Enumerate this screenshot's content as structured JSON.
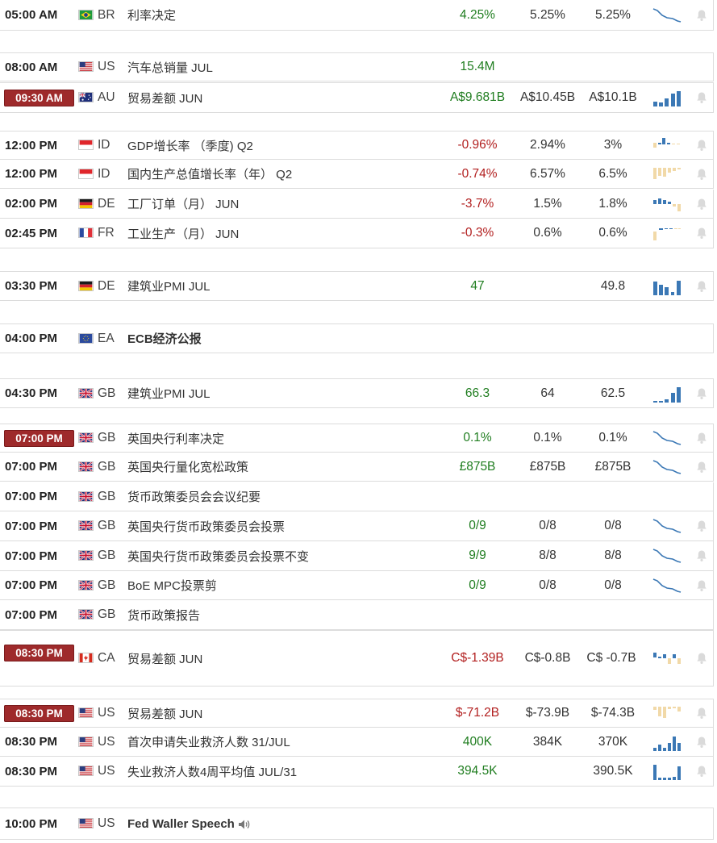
{
  "colors": {
    "positive": "#1f7d1f",
    "negative": "#b21f1f",
    "highlight_time": "#9e2a2b",
    "spark_blue": "#3b78b5",
    "spark_tan": "#f1d9a8"
  },
  "events": [
    {
      "time": "05:00 AM",
      "highlight": false,
      "flag": "BR",
      "country": "BR",
      "event": "利率决定",
      "bold": false,
      "actual": "4.25%",
      "actual_color": "positive",
      "forecast": "5.25%",
      "previous": "5.25%",
      "chart": "line-down",
      "bell": true
    },
    {
      "time": "08:00 AM",
      "highlight": false,
      "flag": "US",
      "country": "US",
      "event": "汽车总销量 JUL",
      "bold": false,
      "actual": "15.4M",
      "actual_color": "positive",
      "forecast": "",
      "previous": "",
      "chart": "none",
      "bell": false
    },
    {
      "time": "09:30 AM",
      "highlight": true,
      "flag": "AU",
      "country": "AU",
      "event": "贸易差额 JUN",
      "bold": false,
      "actual": "A$9.681B",
      "actual_color": "positive",
      "forecast": "A$10.45B",
      "previous": "A$10.1B",
      "chart": "bars-au",
      "bell": true
    },
    {
      "time": "12:00 PM",
      "highlight": false,
      "flag": "ID",
      "country": "ID",
      "event": "GDP增长率 （季度) Q2",
      "bold": false,
      "actual": "-0.96%",
      "actual_color": "negative",
      "forecast": "2.94%",
      "previous": "3%",
      "chart": "bars-id1",
      "bell": true
    },
    {
      "time": "12:00 PM",
      "highlight": false,
      "flag": "ID",
      "country": "ID",
      "event": "国内生产总值增长率（年） Q2",
      "bold": false,
      "actual": "-0.74%",
      "actual_color": "negative",
      "forecast": "6.57%",
      "previous": "6.5%",
      "chart": "bars-id2",
      "bell": true
    },
    {
      "time": "02:00 PM",
      "highlight": false,
      "flag": "DE",
      "country": "DE",
      "event": "工厂订单（月） JUN",
      "bold": false,
      "actual": "-3.7%",
      "actual_color": "negative",
      "forecast": "1.5%",
      "previous": "1.8%",
      "chart": "bars-de1",
      "bell": true
    },
    {
      "time": "02:45 PM",
      "highlight": false,
      "flag": "FR",
      "country": "FR",
      "event": "工业生产（月） JUN",
      "bold": false,
      "actual": "-0.3%",
      "actual_color": "negative",
      "forecast": "0.6%",
      "previous": "0.6%",
      "chart": "bars-fr",
      "bell": true
    },
    {
      "time": "03:30 PM",
      "highlight": false,
      "flag": "DE",
      "country": "DE",
      "event": "建筑业PMI JUL",
      "bold": false,
      "actual": "47",
      "actual_color": "positive",
      "forecast": "",
      "previous": "49.8",
      "chart": "bars-de2",
      "bell": true
    },
    {
      "time": "04:00 PM",
      "highlight": false,
      "flag": "EU",
      "country": "EA",
      "event": "ECB经济公报",
      "bold": true,
      "actual": "",
      "actual_color": "positive",
      "forecast": "",
      "previous": "",
      "chart": "none",
      "bell": false
    },
    {
      "time": "04:30 PM",
      "highlight": false,
      "flag": "GB",
      "country": "GB",
      "event": "建筑业PMI JUL",
      "bold": false,
      "actual": "66.3",
      "actual_color": "positive",
      "forecast": "64",
      "previous": "62.5",
      "chart": "bars-gb",
      "bell": true
    },
    {
      "time": "07:00 PM",
      "highlight": true,
      "flag": "GB",
      "country": "GB",
      "event": "英国央行利率决定",
      "bold": false,
      "actual": "0.1%",
      "actual_color": "positive",
      "forecast": "0.1%",
      "previous": "0.1%",
      "chart": "line-down",
      "bell": true
    },
    {
      "time": "07:00 PM",
      "highlight": false,
      "flag": "GB",
      "country": "GB",
      "event": "英国央行量化宽松政策",
      "bold": false,
      "actual": "£875B",
      "actual_color": "positive",
      "forecast": "£875B",
      "previous": "£875B",
      "chart": "line-down",
      "bell": true
    },
    {
      "time": "07:00 PM",
      "highlight": false,
      "flag": "GB",
      "country": "GB",
      "event": "货币政策委员会会议纪要",
      "bold": false,
      "actual": "",
      "actual_color": "positive",
      "forecast": "",
      "previous": "",
      "chart": "none",
      "bell": false
    },
    {
      "time": "07:00 PM",
      "highlight": false,
      "flag": "GB",
      "country": "GB",
      "event": "英国央行货币政策委员会投票",
      "bold": false,
      "actual": "0/9",
      "actual_color": "positive",
      "forecast": "0/8",
      "previous": "0/8",
      "chart": "line-down",
      "bell": true
    },
    {
      "time": "07:00 PM",
      "highlight": false,
      "flag": "GB",
      "country": "GB",
      "event": "英国央行货币政策委员会投票不变",
      "bold": false,
      "actual": "9/9",
      "actual_color": "positive",
      "forecast": "8/8",
      "previous": "8/8",
      "chart": "line-down",
      "bell": true
    },
    {
      "time": "07:00 PM",
      "highlight": false,
      "flag": "GB",
      "country": "GB",
      "event": "BoE MPC投票剪",
      "bold": false,
      "actual": "0/9",
      "actual_color": "positive",
      "forecast": "0/8",
      "previous": "0/8",
      "chart": "line-down",
      "bell": true
    },
    {
      "time": "07:00 PM",
      "highlight": false,
      "flag": "GB",
      "country": "GB",
      "event": "货币政策报告",
      "bold": false,
      "actual": "",
      "actual_color": "positive",
      "forecast": "",
      "previous": "",
      "chart": "none",
      "bell": false
    },
    {
      "time": "08:30 PM",
      "highlight": true,
      "flag": "CA",
      "country": "CA",
      "event": "贸易差额 JUN",
      "bold": false,
      "actual": "C$-1.39B",
      "actual_color": "negative",
      "forecast": "C$-0.8B",
      "previous": "C$ -0.7B",
      "chart": "bars-ca",
      "bell": true
    },
    {
      "time": "08:30 PM",
      "highlight": true,
      "flag": "US",
      "country": "US",
      "event": "贸易差额 JUN",
      "bold": false,
      "actual": "$-71.2B",
      "actual_color": "negative",
      "forecast": "$-73.9B",
      "previous": "$-74.3B",
      "chart": "bars-us1",
      "bell": true
    },
    {
      "time": "08:30 PM",
      "highlight": false,
      "flag": "US",
      "country": "US",
      "event": "首次申请失业救济人数 31/JUL",
      "bold": false,
      "actual": "400K",
      "actual_color": "positive",
      "forecast": "384K",
      "previous": "370K",
      "chart": "bars-us2",
      "bell": true
    },
    {
      "time": "08:30 PM",
      "highlight": false,
      "flag": "US",
      "country": "US",
      "event": "失业救济人数4周平均值 JUL/31",
      "bold": false,
      "actual": "394.5K",
      "actual_color": "positive",
      "forecast": "",
      "previous": "390.5K",
      "chart": "bars-us3",
      "bell": true
    },
    {
      "time": "10:00 PM",
      "highlight": false,
      "flag": "US",
      "country": "US",
      "event": "Fed Waller Speech",
      "bold": true,
      "speaker": true,
      "actual": "",
      "actual_color": "positive",
      "forecast": "",
      "previous": "",
      "chart": "none",
      "bell": false
    }
  ]
}
